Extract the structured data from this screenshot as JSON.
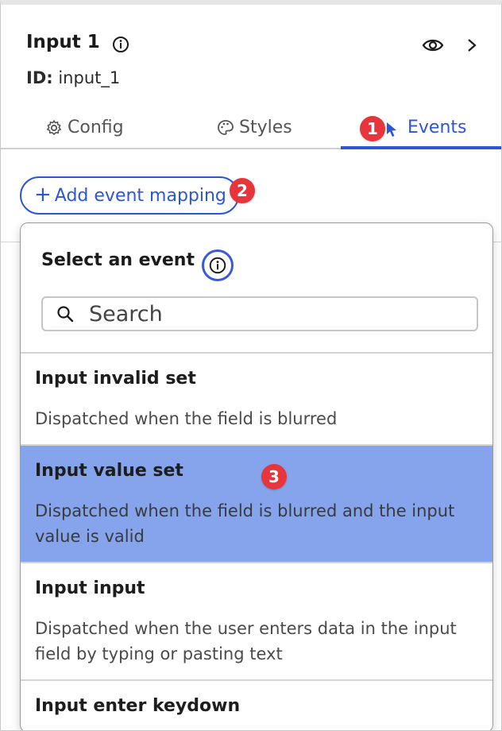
{
  "header": {
    "title": "Input 1",
    "id_key": "ID:",
    "id_value": "input_1"
  },
  "tabs": [
    {
      "label": "Config",
      "icon": "gear-icon"
    },
    {
      "label": "Styles",
      "icon": "palette-icon"
    },
    {
      "label": "Events",
      "icon": "cursor-icon",
      "active": true
    }
  ],
  "add_button": {
    "label": "Add event mapping"
  },
  "badges": {
    "b1": "1",
    "b2": "2",
    "b3": "3"
  },
  "dropdown": {
    "title": "Select an event",
    "search_placeholder": "Search",
    "events": [
      {
        "name": "Input invalid set",
        "description": "Dispatched when the field is blurred"
      },
      {
        "name": "Input value set",
        "description": "Dispatched when the field is blurred and the input value is valid",
        "selected": true
      },
      {
        "name": "Input input",
        "description": "Dispatched when the user enters data in the input field by typing or pasting text"
      },
      {
        "name": "Input enter keydown",
        "description": ""
      }
    ]
  },
  "colors": {
    "accent": "#2d55d7",
    "badge": "#e8343b",
    "selected_row": "#85a4ec"
  }
}
